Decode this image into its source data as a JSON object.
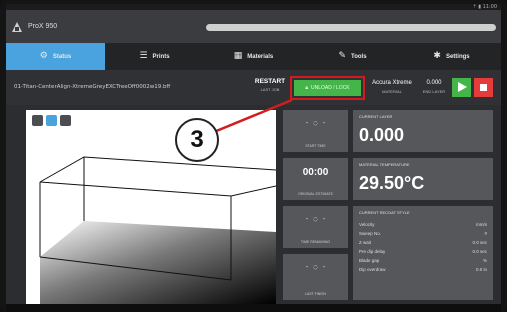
{
  "statusbar": {
    "right_text": "⇡ ▮ 11:00"
  },
  "app": {
    "title": "ProX 950"
  },
  "tabs": [
    {
      "label": "Status",
      "icon": "printer-icon",
      "active": true
    },
    {
      "label": "Prints",
      "icon": "list-icon",
      "active": false
    },
    {
      "label": "Materials",
      "icon": "materials-icon",
      "active": false
    },
    {
      "label": "Tools",
      "icon": "wrench-icon",
      "active": false
    },
    {
      "label": "Settings",
      "icon": "gear-icon",
      "active": false
    }
  ],
  "jobbar": {
    "filename": "01-Titan-CenterAlign-XtremeGreyEXCTreeOff0002w19.bff",
    "restart_label": "RESTART",
    "restart_sub": "LAST JOB",
    "unload_label": "UNLOAD / LOCK",
    "material_name": "Accura Xtreme",
    "material_sub": "MATERIAL",
    "end_value": "0.000",
    "end_sub": "END LAYER"
  },
  "left_buttons": [
    {
      "sym": "- ◌ -",
      "label": "START TIME"
    },
    {
      "big": "00:00",
      "label": "ORIGINAL ESTIMATE"
    },
    {
      "sym": "- ◌ -",
      "label": "TIME REMAINING"
    },
    {
      "sym": "- ◌ -",
      "label": "LAST FINISH"
    }
  ],
  "panels": {
    "current_layer": {
      "title": "CURRENT LAYER",
      "value": "0.000"
    },
    "temperature": {
      "title": "MATERIAL TEMPERATURE",
      "value": "29.50°C"
    },
    "recoat": {
      "title": "CURRENT RECOAT STYLE",
      "rows": [
        {
          "name": "Velocity",
          "val": "mm/s"
        },
        {
          "name": "Sweep No.",
          "val": "#"
        },
        {
          "name": "Z wait",
          "val": "0.0 sec"
        },
        {
          "name": "Pre dip delay",
          "val": "0.0 sec"
        },
        {
          "name": "Blade gap",
          "val": "%"
        },
        {
          "name": "Dip overdraw",
          "val": "0.0 in"
        }
      ]
    }
  },
  "callout": {
    "number": "3"
  },
  "colors": {
    "accent": "#4aa3df",
    "green": "#44b649",
    "red": "#e53b3b",
    "highlight": "#d11d1d"
  }
}
